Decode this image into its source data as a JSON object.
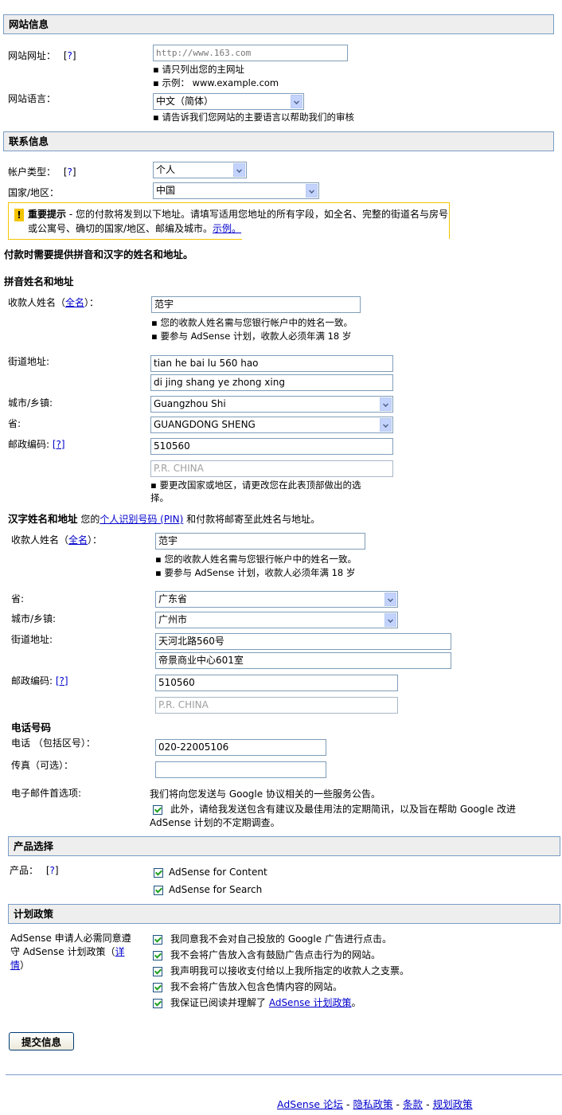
{
  "site_info": {
    "header": "网站信息",
    "url_label": "网站网址：",
    "help_label": "[?]",
    "url_value": "http://www.163.com",
    "url_hints": [
      "▪ 请只列出您的主网址",
      "▪ 示例：  www.example.com"
    ],
    "language_label": "网站语言：",
    "language_value": "中文（简体）",
    "language_hint": "▪ 请告诉我们您网站的主要语言以帮助我们的审核"
  },
  "contact_info": {
    "header": "联系信息",
    "account_type_label": "帐户类型：",
    "help_label": "[?]",
    "account_type_value": "个人",
    "country_label": "国家/地区：",
    "country_value": "中国",
    "notice_icon": "!",
    "notice_title": "重要提示",
    "notice_text": " - 您的付款将发到以下地址。请填写适用您地址的所有字段，如全名、完整的街道名与房号或公寓号、确切的国家/地区、邮编及城市。",
    "notice_link": "示例。",
    "payment_note": "付款时需要提供拼音和汉字的姓名和地址。"
  },
  "pinyin": {
    "header": "拼音姓名和地址",
    "payee_label_pre": "收款人姓名（",
    "payee_label_link": "全名",
    "payee_label_post": "）：",
    "payee_value": "范宇",
    "payee_hints": [
      "▪ 您的收款人姓名需与您银行帐户中的姓名一致。",
      "▪ 要参与  AdSense 计划，收款人必须年满  18 岁"
    ],
    "street_label": "街道地址:",
    "street1": "tian he bai lu 560 hao",
    "street2": "di jing shang ye zhong xing",
    "city_label": "城市/乡镇:",
    "city_value": "Guangzhou Shi",
    "province_label": "省:",
    "province_value": "GUANGDONG SHENG",
    "postal_label": "邮政编码:",
    "help_label": "[?]",
    "postal_value": "510560",
    "country_value": "P.R. CHINA",
    "country_hint_1": "▪ 要更改国家或地区，请更改您在此表顶部做出的选",
    "country_hint_2": "择。"
  },
  "hanzi": {
    "header": "汉字姓名和地址",
    "intro_pre": " 您的",
    "intro_link": "个人识别号码 (PIN)",
    "intro_post": " 和付款将邮寄至此姓名与地址。",
    "payee_label_pre": "收款人姓名（",
    "payee_label_link": "全名",
    "payee_label_post": "）：",
    "payee_value": "范宇",
    "payee_hints": [
      "▪ 您的收款人姓名需与您银行帐户中的姓名一致。",
      "▪ 要参与  AdSense 计划，收款人必须年满  18 岁"
    ],
    "province_label": "省:",
    "province_value": "广东省",
    "city_label": "城市/乡镇:",
    "city_value": "广州市",
    "street_label": "街道地址:",
    "street1": "天河北路560号",
    "street2": "帝景商业中心601室",
    "postal_label": "邮政编码:",
    "help_label": "[?]",
    "postal_value": "510560",
    "country_value": "P.R. CHINA"
  },
  "phone": {
    "header": "电话号码",
    "phone_label": "电话  （包括区号）：",
    "phone_value": "020-22005106",
    "fax_label": "传真（可选）：",
    "fax_value": "",
    "email_label": "电子邮件首选项:",
    "email_note": "我们将向您发送与  Google 协议相关的一些服务公告。",
    "email_opt_line1": "此外，请给我发送包含有建议及最佳用法的定期简讯，以及旨在帮助  Google 改进",
    "email_opt_line2": "AdSense 计划的不定期调查。",
    "email_opt_checked": true
  },
  "products": {
    "header": "产品选择",
    "label": "产品：",
    "help_label": "[?]",
    "items": [
      {
        "label": "AdSense for Content",
        "checked": true
      },
      {
        "label": "AdSense for Search",
        "checked": true
      }
    ]
  },
  "policy": {
    "header": "计划政策",
    "desc_line1": "AdSense 申请人必需同意遵",
    "desc_line2_pre": "守  AdSense 计划政策（",
    "desc_link_1": "详",
    "desc_link_2": "情",
    "desc_line3_post": "）",
    "items": [
      {
        "label": "我同意我不会对自己投放的  Google 广告进行点击。",
        "checked": true
      },
      {
        "label": "我不会将广告放入含有鼓励广告点击行为的网站。",
        "checked": true
      },
      {
        "label": "我声明我可以接收支付给以上我所指定的收款人之支票。",
        "checked": true
      },
      {
        "label": "我不会将广告放入包含色情内容的网站。",
        "checked": true
      },
      {
        "label": "我保证已阅读并理解了  ",
        "link": "AdSense 计划政策",
        "post": "。",
        "checked": true
      }
    ]
  },
  "submit_label": "提交信息",
  "footer": {
    "links": [
      "AdSense 论坛",
      "隐私政策",
      "条款",
      "规划政策"
    ],
    "separator": "-"
  }
}
